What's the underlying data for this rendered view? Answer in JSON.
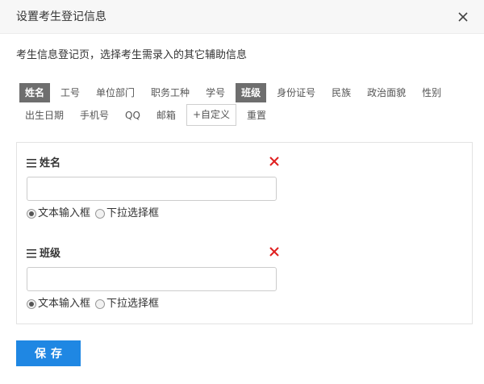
{
  "dialog": {
    "title": "设置考生登记信息",
    "close_icon": "close-icon"
  },
  "description": "考生信息登记页，选择考生需录入的其它辅助信息",
  "tags_row1": [
    {
      "label": "姓名",
      "selected": true
    },
    {
      "label": "工号",
      "selected": false
    },
    {
      "label": "单位部门",
      "selected": false
    },
    {
      "label": "职务工种",
      "selected": false
    },
    {
      "label": "学号",
      "selected": false
    },
    {
      "label": "班级",
      "selected": true
    },
    {
      "label": "身份证号",
      "selected": false
    },
    {
      "label": "民族",
      "selected": false
    },
    {
      "label": "政治面貌",
      "selected": false
    },
    {
      "label": "性别",
      "selected": false
    }
  ],
  "tags_row2": [
    {
      "label": "出生日期",
      "selected": false
    },
    {
      "label": "手机号",
      "selected": false
    },
    {
      "label": "QQ",
      "selected": false
    },
    {
      "label": "邮箱",
      "selected": false
    },
    {
      "label": "+自定义",
      "selected": false
    },
    {
      "label": "重置",
      "selected": false
    }
  ],
  "fields": [
    {
      "label": "姓名",
      "value": "",
      "options": [
        {
          "label": "文本输入框",
          "checked": true
        },
        {
          "label": "下拉选择框",
          "checked": false
        }
      ]
    },
    {
      "label": "班级",
      "value": "",
      "options": [
        {
          "label": "文本输入框",
          "checked": true
        },
        {
          "label": "下拉选择框",
          "checked": false
        }
      ]
    }
  ],
  "colors": {
    "accent": "#1f87e3",
    "remove": "#e02020",
    "tag_active_bg": "#6e6e6e"
  },
  "save_label": "保存"
}
